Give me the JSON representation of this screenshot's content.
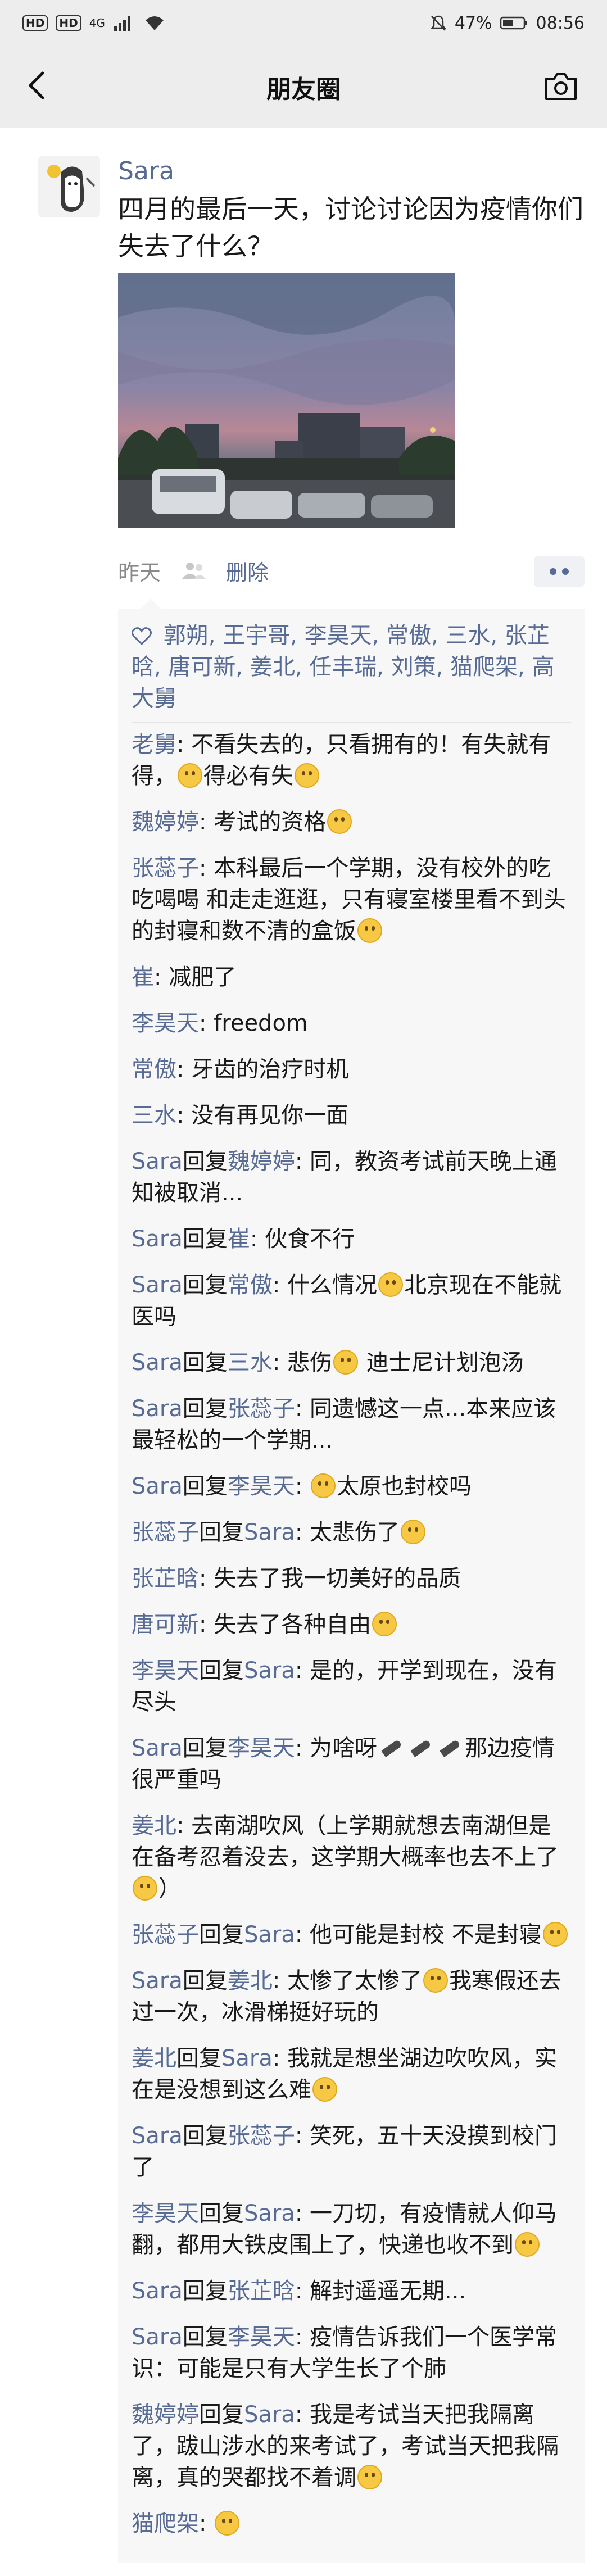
{
  "status": {
    "left_chips": [
      "HD",
      "HD"
    ],
    "network": "4G",
    "battery": "47%",
    "time": "08:56"
  },
  "nav": {
    "title": "朋友圈"
  },
  "post": {
    "author": "Sara",
    "text": "四月的最后一天，讨论讨论因为疫情你们失去了什么？",
    "time": "昨天",
    "delete_label": "删除"
  },
  "likes": {
    "names": "郭朔, 王宇哥, 李昊天, 常傲, 三水, 张芷晗, 唐可新, 姜北, 任丰瑞, 刘策, 猫爬架, 高大舅"
  },
  "comments": [
    {
      "name": "老舅",
      "text": ": 不看失去的，只看拥有的！有失就有得，",
      "emo": true,
      "tail": "得必有失",
      "emo2": true
    },
    {
      "name": "魏婷婷",
      "text": ": 考试的资格",
      "emo": true
    },
    {
      "name": "张蕊子",
      "text": ": 本科最后一个学期，没有校外的吃吃喝喝 和走走逛逛，只有寝室楼里看不到头的封寝和数不清的盒饭",
      "emo": true
    },
    {
      "name": "崔",
      "text": ": 减肥了"
    },
    {
      "name": "李昊天",
      "text": ": freedom"
    },
    {
      "name": "常傲",
      "text": ": 牙齿的治疗时机"
    },
    {
      "name": "三水",
      "text": ": 没有再见你一面"
    },
    {
      "name": "Sara",
      "reply": "回复",
      "to": "魏婷婷",
      "text": ": 同，教资考试前天晚上通知被取消..."
    },
    {
      "name": "Sara",
      "reply": "回复",
      "to": "崔",
      "text": ": 伙食不行"
    },
    {
      "name": "Sara",
      "reply": "回复",
      "to": "常傲",
      "text": ": 什么情况",
      "emo": true,
      "tail": "北京现在不能就医吗"
    },
    {
      "name": "Sara",
      "reply": "回复",
      "to": "三水",
      "text": ": 悲伤",
      "emo": true,
      "tail": " 迪士尼计划泡汤"
    },
    {
      "name": "Sara",
      "reply": "回复",
      "to": "张蕊子",
      "text": ": 同遗憾这一点...本来应该最轻松的一个学期..."
    },
    {
      "name": "Sara",
      "reply": "回复",
      "to": "李昊天",
      "text": ": ",
      "emo": true,
      "tail": "太原也封校吗"
    },
    {
      "name": "张蕊子",
      "reply": "回复",
      "to": "Sara",
      "text": ": 太悲伤了",
      "emo": true
    },
    {
      "name": "张芷晗",
      "text": ": 失去了我一切美好的品质"
    },
    {
      "name": "唐可新",
      "text": ": 失去了各种自由",
      "emo": true
    },
    {
      "name": "李昊天",
      "reply": "回复",
      "to": "Sara",
      "text": ": 是的，开学到现在，没有尽头"
    },
    {
      "name": "Sara",
      "reply": "回复",
      "to": "李昊天",
      "text": ": 为啥呀",
      "knives": true,
      "tail": "那边疫情很严重吗"
    },
    {
      "name": "姜北",
      "text": ": 去南湖吹风（上学期就想去南湖但是在备考忍着没去，这学期大概率也去不上了",
      "emo": true,
      "tail": "）"
    },
    {
      "name": "张蕊子",
      "reply": "回复",
      "to": "Sara",
      "text": ": 他可能是封校 不是封寝",
      "emo": true
    },
    {
      "name": "Sara",
      "reply": "回复",
      "to": "姜北",
      "text": ": 太惨了太惨了",
      "emo": true,
      "tail": "我寒假还去过一次，冰滑梯挺好玩的"
    },
    {
      "name": "姜北",
      "reply": "回复",
      "to": "Sara",
      "text": ": 我就是想坐湖边吹吹风，实在是没想到这么难",
      "emo": true
    },
    {
      "name": "Sara",
      "reply": "回复",
      "to": "张蕊子",
      "text": ": 笑死，五十天没摸到校门了"
    },
    {
      "name": "李昊天",
      "reply": "回复",
      "to": "Sara",
      "text": ": 一刀切，有疫情就人仰马翻，都用大铁皮围上了，快递也收不到",
      "emo": true
    },
    {
      "name": "Sara",
      "reply": "回复",
      "to": "张芷晗",
      "text": ": 解封遥遥无期..."
    },
    {
      "name": "Sara",
      "reply": "回复",
      "to": "李昊天",
      "text": ": 疫情告诉我们一个医学常识：可能是只有大学生长了个肺"
    },
    {
      "name": "魏婷婷",
      "reply": "回复",
      "to": "Sara",
      "text": ": 我是考试当天把我隔离了，跋山涉水的来考试了，考试当天把我隔离，真的哭都找不着调",
      "emo": true
    },
    {
      "name": "猫爬架",
      "text": ": ",
      "emo": true
    }
  ]
}
